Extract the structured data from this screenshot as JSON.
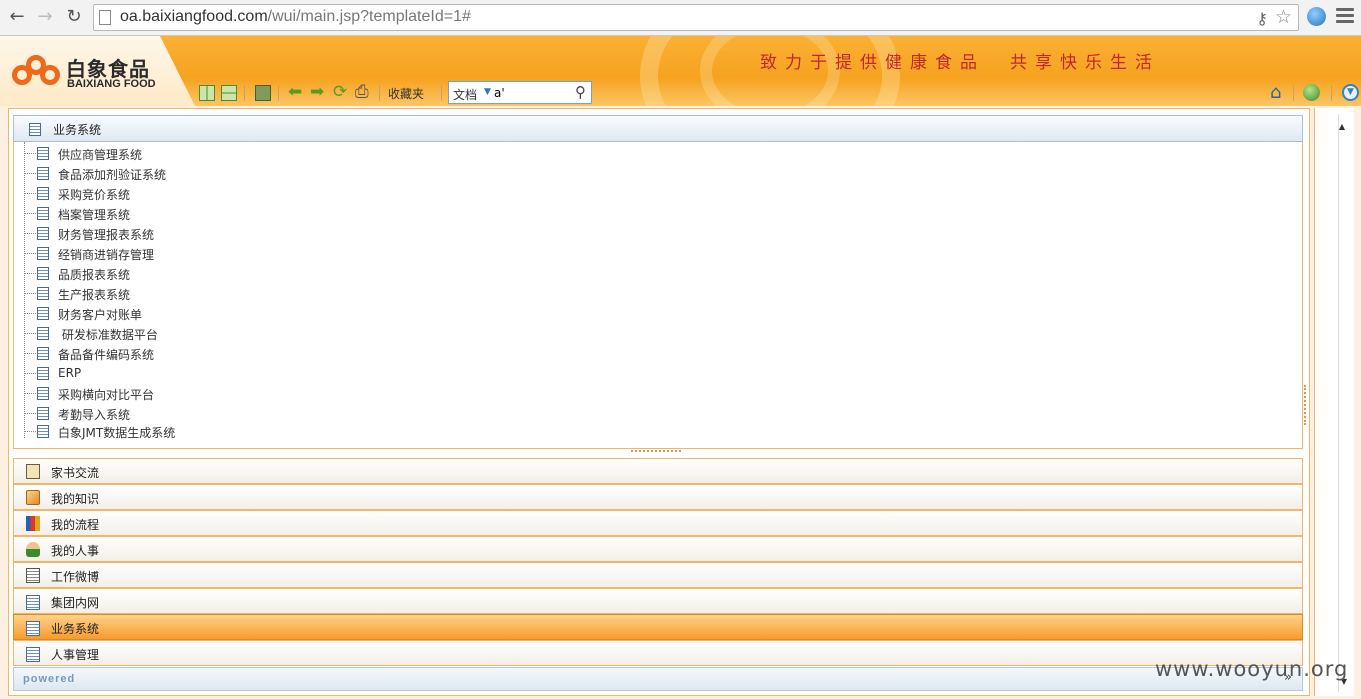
{
  "browser": {
    "url_host": "oa.baixiangfood.com",
    "url_path": "/wui/main.jsp?templateId=1#"
  },
  "header": {
    "logo_cn": "白象食品",
    "logo_en": "BAIXIANG FOOD",
    "slogan": "致力于提供健康食品　共享快乐生活"
  },
  "toolbar": {
    "favorites_label": "收藏夹",
    "search_category": "文档",
    "search_value": "a'"
  },
  "panel": {
    "title": "业务系统",
    "items": [
      "供应商管理系统",
      "食品添加剂验证系统",
      "采购竞价系统",
      "档案管理系统",
      "财务管理报表系统",
      "经销商进销存管理",
      "品质报表系统",
      "生产报表系统",
      "财务客户对账单",
      " 研发标准数据平台",
      "备品备件编码系统",
      "ERP",
      "采购横向对比平台",
      "考勤导入系统",
      "白象JMT数据生成系统"
    ]
  },
  "accordion": [
    {
      "label": "家书交流",
      "icon": "clipboard-icon"
    },
    {
      "label": "我的知识",
      "icon": "knowledge-icon"
    },
    {
      "label": "我的流程",
      "icon": "workflow-icon"
    },
    {
      "label": "我的人事",
      "icon": "user-icon"
    },
    {
      "label": "工作微博",
      "icon": "microblog-icon"
    },
    {
      "label": "集团内网",
      "icon": "document-icon"
    },
    {
      "label": "业务系统",
      "icon": "document-icon",
      "active": true
    },
    {
      "label": "人事管理",
      "icon": "document-icon"
    }
  ],
  "footer": {
    "powered": "powered"
  },
  "watermark": "www.wooyun.org",
  "colors": {
    "header_orange": "#f6a21f",
    "active_tab": "#f79b2c",
    "slogan_red": "#c0282a"
  }
}
